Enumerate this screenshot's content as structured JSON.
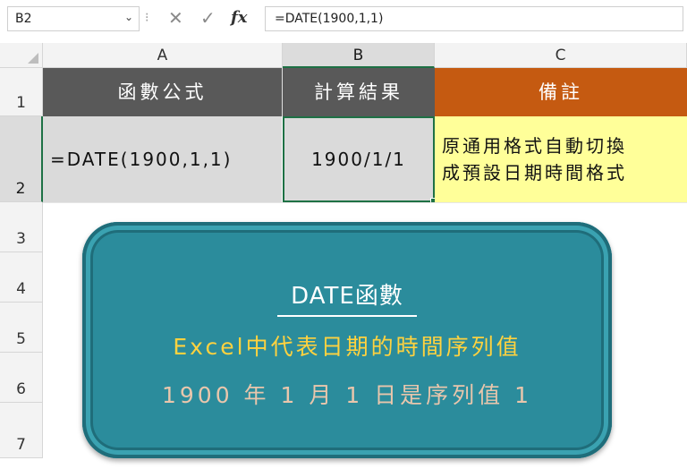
{
  "formula_bar": {
    "name_box": "B2",
    "formula": "=DATE(1900,1,1)",
    "fx_label": "fx"
  },
  "columns": [
    "A",
    "B",
    "C"
  ],
  "rows": [
    "1",
    "2",
    "3",
    "4",
    "5",
    "6",
    "7"
  ],
  "cells": {
    "A1": "函數公式",
    "B1": "計算結果",
    "C1": "備註",
    "A2": "=DATE(1900,1,1)",
    "B2": "1900/1/1",
    "C2_line1": "原通用格式自動切換",
    "C2_line2": "成預設日期時間格式"
  },
  "callout": {
    "title": "DATE函數",
    "line1": "Excel中代表日期的時間序列值",
    "line2": "1900 年 1 月 1 日是序列值 1"
  },
  "colors": {
    "header_gray": "#595959",
    "header_orange": "#c55a11",
    "note_yellow": "#ffff99",
    "selection_green": "#1e7145",
    "callout_teal": "#2b8c9c",
    "callout_line1": "#ffd23f",
    "callout_line2": "#e9c6ac"
  },
  "icons": [
    "chevron-down-icon",
    "cancel-x-icon",
    "check-icon",
    "fx-icon"
  ]
}
